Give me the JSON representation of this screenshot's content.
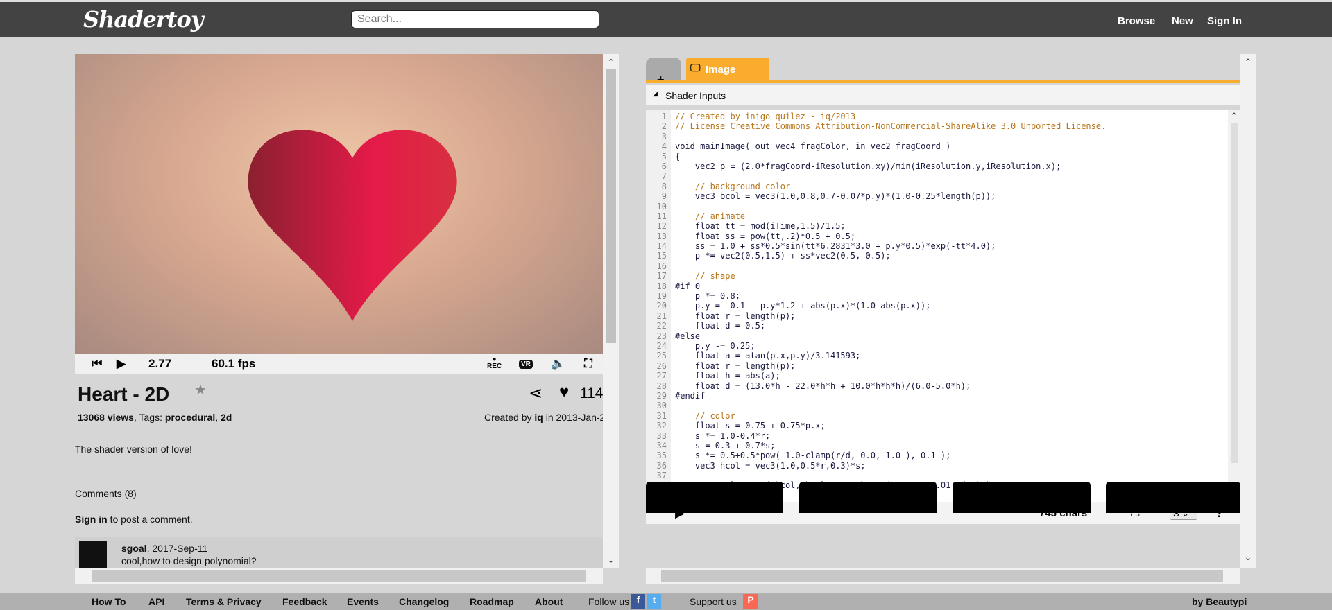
{
  "header": {
    "logo": "Shadertoy",
    "search_placeholder": "Search...",
    "nav": [
      "Browse",
      "New",
      "Sign In"
    ]
  },
  "player": {
    "time": "2.77",
    "fps": "60.1 fps",
    "rec_label": "REC",
    "vr_label": "VR"
  },
  "shader": {
    "title": "Heart - 2D",
    "likes": "114",
    "views": "13068 views",
    "tags_label": "Tags:",
    "tags": [
      "procedural",
      "2d"
    ],
    "created_by_label": "Created by",
    "author": "iq",
    "date_prefix": "in",
    "date": "2013-Jan-2",
    "description": "The shader version of love!"
  },
  "comments": {
    "header": "Comments (8)",
    "sign_in": "Sign in",
    "sign_in_suffix": "to post a comment.",
    "items": [
      {
        "user": "sgoal",
        "date": ", 2017-Sep-11",
        "text": "cool,how to design polynomial?"
      }
    ]
  },
  "editor": {
    "tab_label": "Image",
    "inputs_label": "Shader Inputs",
    "chars": "745 chars",
    "font_select": "S",
    "help": "?",
    "code": [
      "// Created by inigo quilez - iq/2013",
      "// License Creative Commons Attribution-NonCommercial-ShareAlike 3.0 Unported License.",
      "",
      "void mainImage( out vec4 fragColor, in vec2 fragCoord )",
      "{",
      "    vec2 p = (2.0*fragCoord-iResolution.xy)/min(iResolution.y,iResolution.x);",
      "",
      "    // background color",
      "    vec3 bcol = vec3(1.0,0.8,0.7-0.07*p.y)*(1.0-0.25*length(p));",
      "",
      "    // animate",
      "    float tt = mod(iTime,1.5)/1.5;",
      "    float ss = pow(tt,.2)*0.5 + 0.5;",
      "    ss = 1.0 + ss*0.5*sin(tt*6.2831*3.0 + p.y*0.5)*exp(-tt*4.0);",
      "    p *= vec2(0.5,1.5) + ss*vec2(0.5,-0.5);",
      "",
      "    // shape",
      "#if 0",
      "    p *= 0.8;",
      "    p.y = -0.1 - p.y*1.2 + abs(p.x)*(1.0-abs(p.x));",
      "    float r = length(p);",
      "    float d = 0.5;",
      "#else",
      "    p.y -= 0.25;",
      "    float a = atan(p.x,p.y)/3.141593;",
      "    float r = length(p);",
      "    float h = abs(a);",
      "    float d = (13.0*h - 22.0*h*h + 10.0*h*h*h)/(6.0-5.0*h);",
      "#endif",
      "",
      "    // color",
      "    float s = 0.75 + 0.75*p.x;",
      "    s *= 1.0-0.4*r;",
      "    s = 0.3 + 0.7*s;",
      "    s *= 0.5+0.5*pow( 1.0-clamp(r/d, 0.0, 1.0 ), 0.1 );",
      "    vec3 hcol = vec3(1.0,0.5*r,0.3)*s;",
      "",
      "    vec3 col = mix( bcol, hcol, smoothstep( -0.01, 0.01, d-r) );",
      ""
    ]
  },
  "footer": {
    "links": [
      "How To",
      "API",
      "Terms & Privacy",
      "Feedback",
      "Events",
      "Changelog",
      "Roadmap",
      "About"
    ],
    "follow": "Follow us",
    "support": "Support us",
    "by": "by Beautypi"
  },
  "colors": {
    "accent": "#f9ac2e",
    "header": "#434343"
  }
}
